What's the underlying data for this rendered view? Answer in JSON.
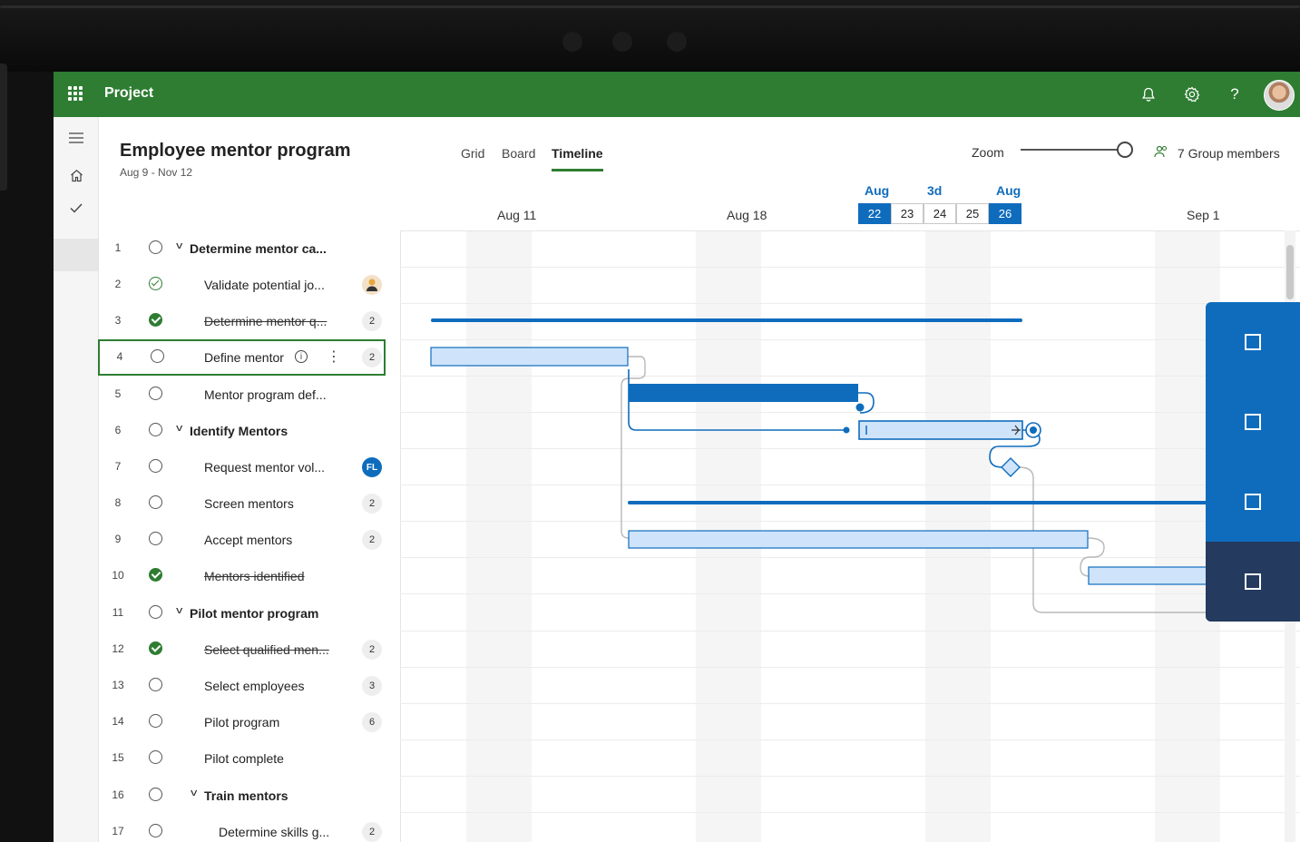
{
  "app": {
    "name": "Project"
  },
  "project": {
    "title": "Employee mentor program",
    "date_range": "Aug 9 - Nov 12"
  },
  "views": {
    "tabs": [
      {
        "label": "Grid"
      },
      {
        "label": "Board"
      },
      {
        "label": "Timeline"
      }
    ],
    "active": "Timeline"
  },
  "zoom": {
    "label": "Zoom",
    "level": 1.0
  },
  "members": {
    "label": "7 Group members"
  },
  "timeline_header": {
    "weeks": [
      "Aug 11",
      "Aug 18",
      "Sep 1"
    ],
    "zoom_months": [
      "Aug",
      "3d",
      "Aug"
    ],
    "days": [
      {
        "label": "22",
        "selected": true
      },
      {
        "label": "23",
        "selected": false
      },
      {
        "label": "24",
        "selected": false
      },
      {
        "label": "25",
        "selected": false
      },
      {
        "label": "26",
        "selected": true
      }
    ]
  },
  "tasks": [
    {
      "num": "1",
      "name": "Determine mentor ca...",
      "group": true,
      "status": "open",
      "badge": ""
    },
    {
      "num": "2",
      "name": "Validate potential jo...",
      "group": false,
      "status": "checked",
      "badge": "person"
    },
    {
      "num": "3",
      "name": "Determine mentor q...",
      "group": false,
      "status": "done",
      "badge": "2"
    },
    {
      "num": "4",
      "name": "Define mentor",
      "group": false,
      "status": "open",
      "badge": "2"
    },
    {
      "num": "5",
      "name": "Mentor program def...",
      "group": false,
      "status": "open",
      "badge": ""
    },
    {
      "num": "6",
      "name": "Identify Mentors",
      "group": true,
      "status": "open",
      "badge": ""
    },
    {
      "num": "7",
      "name": "Request mentor vol...",
      "group": false,
      "status": "open",
      "badge": "FL"
    },
    {
      "num": "8",
      "name": "Screen mentors",
      "group": false,
      "status": "open",
      "badge": "2"
    },
    {
      "num": "9",
      "name": "Accept mentors",
      "group": false,
      "status": "open",
      "badge": "2"
    },
    {
      "num": "10",
      "name": "Mentors identified",
      "group": false,
      "status": "done",
      "badge": ""
    },
    {
      "num": "11",
      "name": "Pilot mentor program",
      "group": true,
      "status": "open",
      "badge": ""
    },
    {
      "num": "12",
      "name": "Select qualified men...",
      "group": false,
      "status": "done",
      "badge": "2"
    },
    {
      "num": "13",
      "name": "Select employees",
      "group": false,
      "status": "open",
      "badge": "3"
    },
    {
      "num": "14",
      "name": "Pilot program",
      "group": false,
      "status": "open",
      "badge": "6"
    },
    {
      "num": "15",
      "name": "Pilot complete",
      "group": false,
      "status": "open",
      "badge": ""
    },
    {
      "num": "16",
      "name": "Train mentors",
      "group": true,
      "status": "open",
      "badge": ""
    },
    {
      "num": "17",
      "name": "Determine skills g...",
      "group": false,
      "status": "open",
      "badge": "2"
    }
  ],
  "colors": {
    "topbar": "#2e7d32",
    "accent": "#0f6cbd",
    "bar_light": "#cfe4fa",
    "panel_dark": "#243a5e"
  }
}
